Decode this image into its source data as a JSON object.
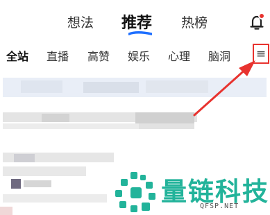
{
  "top_tabs": [
    {
      "label": "想法"
    },
    {
      "label": "推荐"
    },
    {
      "label": "热榜"
    }
  ],
  "active_tab": "推荐",
  "icons": {
    "bell": "bell-icon",
    "menu": "menu-icon"
  },
  "menu_glyph": "≡",
  "categories": [
    {
      "label": "全站"
    },
    {
      "label": "直播"
    },
    {
      "label": "高赞"
    },
    {
      "label": "娱乐"
    },
    {
      "label": "心理"
    },
    {
      "label": "脑洞"
    }
  ],
  "active_category": "全站",
  "colors": {
    "accent": "#1e6fff",
    "notification": "#e8332f",
    "annotation": "#e8332f",
    "watermark": "#22b39a"
  },
  "watermark": {
    "title": "量链科技",
    "subtitle": "QFSP.NET"
  }
}
